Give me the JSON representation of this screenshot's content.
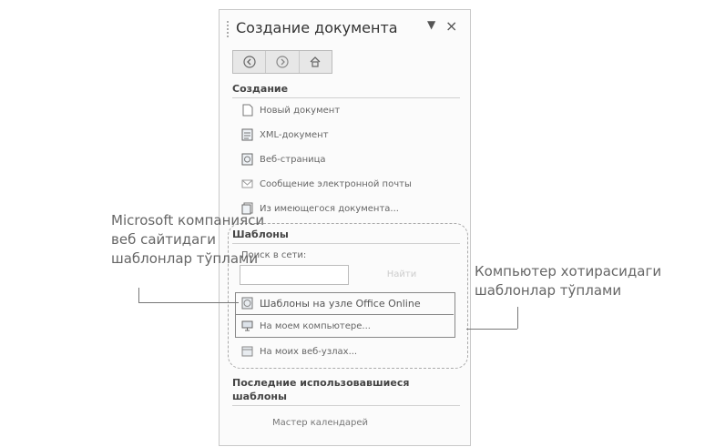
{
  "panel": {
    "title": "Создание документа",
    "dropdown_glyph": "▼",
    "close_glyph": "×"
  },
  "nav": {
    "icons": [
      "back-icon",
      "forward-icon",
      "home-icon"
    ]
  },
  "create_section": {
    "title": "Создание",
    "items": [
      {
        "label": "Новый документ",
        "icon": "blank-document-icon"
      },
      {
        "label": "XML-документ",
        "icon": "xml-document-icon"
      },
      {
        "label": "Веб-страница",
        "icon": "web-page-icon"
      },
      {
        "label": "Сообщение электронной почты",
        "icon": "email-icon"
      },
      {
        "label": "Из имеющегося документа...",
        "icon": "existing-document-icon"
      }
    ]
  },
  "templates_section": {
    "title": "Шаблоны",
    "search_label": "Поиск в сети:",
    "search_value": "",
    "search_button": "Найти",
    "items": [
      {
        "label": "Шаблоны на узле Office Online",
        "icon": "office-online-icon"
      },
      {
        "label": "На моем компьютере...",
        "icon": "my-computer-icon"
      },
      {
        "label": "На моих веб-узлах...",
        "icon": "my-websites-icon"
      }
    ]
  },
  "recent_section": {
    "title": "Последние использовавшиеся шаблоны",
    "items": [
      "Мастер календарей"
    ]
  },
  "callouts": {
    "left_lines": [
      "Microsoft компанияси",
      "веб сайтидаги",
      "шаблонлар тўплами"
    ],
    "right_lines": [
      "Компьютер хотирасидаги",
      "шаблонлар тўплами"
    ]
  }
}
